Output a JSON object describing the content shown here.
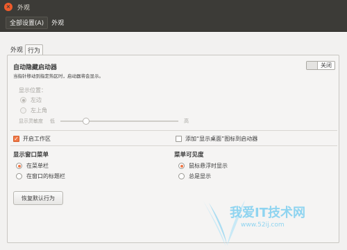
{
  "window": {
    "title": "外观",
    "close_glyph": "×"
  },
  "toolbar": {
    "all_settings": "全部设置(A)",
    "current": "外观"
  },
  "tabs": [
    {
      "label": "外观",
      "active": false
    },
    {
      "label": "行为",
      "active": true
    }
  ],
  "autohide": {
    "title": "自动隐藏启动器",
    "description": "当指针移动到指定热区时，启动器将会显示。",
    "switch_label": "关闭",
    "switch_on": false,
    "reveal_label": "显示位置：",
    "reveal_options": [
      {
        "label": "左边",
        "selected": true
      },
      {
        "label": "左上角",
        "selected": false
      }
    ],
    "sensitivity_label": "显示灵敏度",
    "sensitivity_low": "低",
    "sensitivity_high": "高",
    "sensitivity_value": 0.2
  },
  "workspaces": {
    "label": "开启工作区",
    "checked": true
  },
  "show_desktop": {
    "label": "添加“显示桌面”图标到启动器",
    "checked": false
  },
  "window_menu": {
    "title": "显示窗口菜单",
    "options": [
      {
        "label": "在菜单栏",
        "selected": true
      },
      {
        "label": "在窗口的标题栏",
        "selected": false
      }
    ]
  },
  "menu_visibility": {
    "title": "菜单可见度",
    "options": [
      {
        "label": "鼠标悬浮时显示",
        "selected": true
      },
      {
        "label": "总是显示",
        "selected": false
      }
    ]
  },
  "reset_button": "恢复默认行为",
  "watermark": {
    "text": "我爱IT技术网",
    "url": "www.52ij.com"
  },
  "colors": {
    "accent": "#f07746",
    "titlebar": "#3c3b37",
    "background": "#f2f1f0",
    "watermark": "#8fd4f0"
  }
}
